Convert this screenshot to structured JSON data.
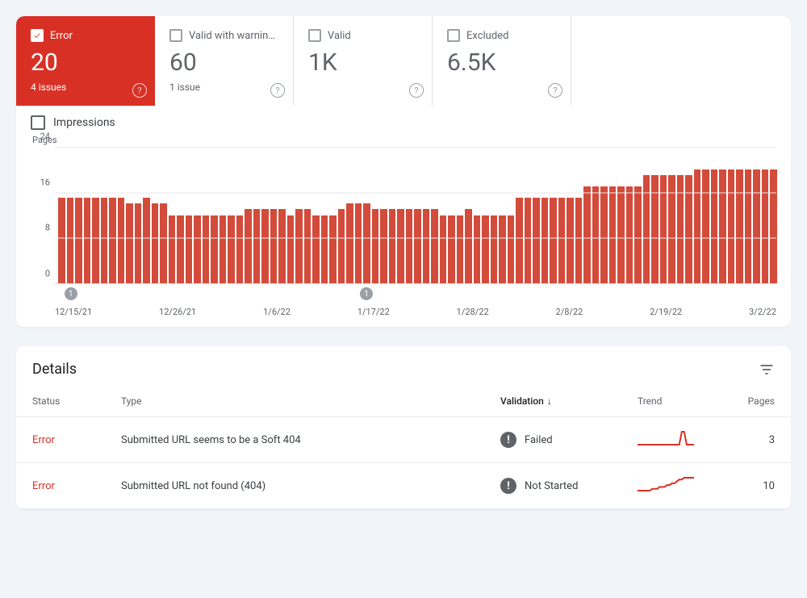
{
  "status_cards": [
    {
      "label": "Error",
      "value": "20",
      "sub": "4 issues",
      "checked": true,
      "theme": "error"
    },
    {
      "label": "Valid with warnin…",
      "value": "60",
      "sub": "1 issue",
      "checked": false,
      "theme": "plain"
    },
    {
      "label": "Valid",
      "value": "1K",
      "sub": "",
      "checked": false,
      "theme": "plain"
    },
    {
      "label": "Excluded",
      "value": "6.5K",
      "sub": "",
      "checked": false,
      "theme": "plain"
    }
  ],
  "impressions": {
    "label": "Impressions",
    "checked": false
  },
  "chart_data": {
    "type": "bar",
    "title": "",
    "ylabel": "Pages",
    "xlabel": "",
    "ylim": [
      0,
      24
    ],
    "y_ticks": [
      0,
      8,
      16,
      24
    ],
    "x_ticks": [
      "12/15/21",
      "12/26/21",
      "1/6/22",
      "1/17/22",
      "1/28/22",
      "2/8/22",
      "2/19/22",
      "3/2/22"
    ],
    "categories": [
      "12/15/21",
      "12/16/21",
      "12/17/21",
      "12/18/21",
      "12/19/21",
      "12/20/21",
      "12/21/21",
      "12/22/21",
      "12/23/21",
      "12/24/21",
      "12/25/21",
      "12/26/21",
      "12/27/21",
      "12/28/21",
      "12/29/21",
      "12/30/21",
      "12/31/21",
      "1/1/22",
      "1/2/22",
      "1/3/22",
      "1/4/22",
      "1/5/22",
      "1/6/22",
      "1/7/22",
      "1/8/22",
      "1/9/22",
      "1/10/22",
      "1/11/22",
      "1/12/22",
      "1/13/22",
      "1/14/22",
      "1/15/22",
      "1/16/22",
      "1/17/22",
      "1/18/22",
      "1/19/22",
      "1/20/22",
      "1/21/22",
      "1/22/22",
      "1/23/22",
      "1/24/22",
      "1/25/22",
      "1/26/22",
      "1/27/22",
      "1/28/22",
      "1/29/22",
      "1/30/22",
      "1/31/22",
      "2/1/22",
      "2/2/22",
      "2/3/22",
      "2/4/22",
      "2/5/22",
      "2/6/22",
      "2/7/22",
      "2/8/22",
      "2/9/22",
      "2/10/22",
      "2/11/22",
      "2/12/22",
      "2/13/22",
      "2/14/22",
      "2/15/22",
      "2/16/22",
      "2/17/22",
      "2/18/22",
      "2/19/22",
      "2/20/22",
      "2/21/22",
      "2/22/22",
      "2/23/22",
      "2/24/22",
      "2/25/22",
      "2/26/22",
      "2/27/22",
      "2/28/22",
      "3/1/22",
      "3/2/22",
      "3/3/22",
      "3/4/22",
      "3/5/22",
      "3/6/22",
      "3/7/22",
      "3/8/22",
      "3/9/22"
    ],
    "values": [
      15,
      15,
      15,
      15,
      15,
      15,
      15,
      15,
      14,
      14,
      15,
      14,
      14,
      12,
      12,
      12,
      12,
      12,
      12,
      12,
      12,
      12,
      13,
      13,
      13,
      13,
      13,
      12,
      13,
      13,
      12,
      12,
      12,
      13,
      14,
      14,
      14,
      13,
      13,
      13,
      13,
      13,
      13,
      13,
      13,
      12,
      12,
      12,
      13,
      12,
      12,
      12,
      12,
      12,
      15,
      15,
      15,
      15,
      15,
      15,
      15,
      15,
      17,
      17,
      17,
      17,
      17,
      17,
      17,
      19,
      19,
      19,
      19,
      19,
      19,
      20,
      20,
      20,
      20,
      20,
      20,
      20,
      20,
      20,
      20
    ],
    "annotations": [
      {
        "index": 1,
        "label": "1"
      },
      {
        "index": 36,
        "label": "1"
      }
    ]
  },
  "details": {
    "title": "Details",
    "columns": {
      "status": "Status",
      "type": "Type",
      "validation": "Validation",
      "trend": "Trend",
      "pages": "Pages"
    },
    "sort_column": "validation",
    "sort_dir": "desc",
    "rows": [
      {
        "status": "Error",
        "type": "Submitted URL seems to be a Soft 404",
        "validation": "Failed",
        "trend": [
          3,
          3,
          3,
          3,
          3,
          3,
          3,
          3,
          3,
          3,
          3,
          3,
          3,
          3,
          3,
          3,
          3,
          3,
          3.2,
          3.2,
          3,
          3,
          3,
          3
        ],
        "pages": "3"
      },
      {
        "status": "Error",
        "type": "Submitted URL not found (404)",
        "validation": "Not Started",
        "trend": [
          3,
          3,
          3,
          3,
          3,
          3,
          4,
          4,
          4,
          5,
          5,
          5,
          6,
          6,
          7,
          7,
          8,
          9,
          9,
          10,
          10,
          10,
          10,
          10
        ],
        "pages": "10"
      }
    ]
  }
}
